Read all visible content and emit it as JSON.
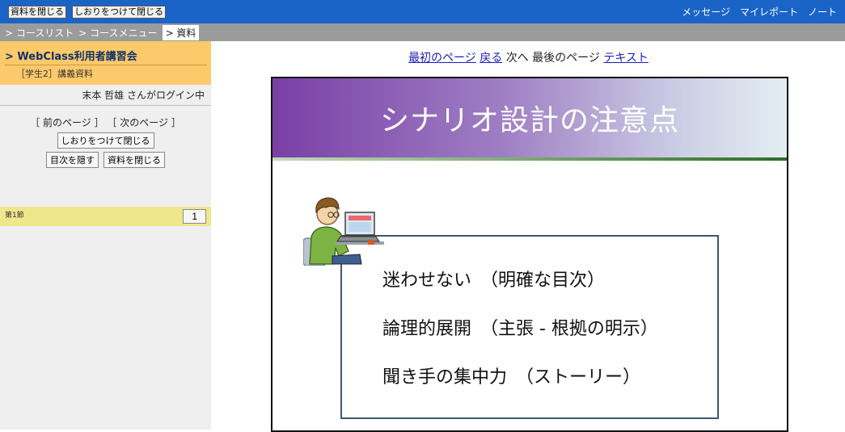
{
  "topbar": {
    "close_button": "資料を閉じる",
    "bookmark_close_button": "しおりをつけて閉じる",
    "links": [
      "メッセージ",
      "マイレポート",
      "ノート"
    ]
  },
  "breadcrumbs": [
    "> コースリスト",
    "> コースメニュー",
    "> 資料"
  ],
  "sidebar": {
    "course_title": "> WebClass利用者講習会",
    "course_sub": "［学生2］講義資料",
    "login_text": "末本 哲雄 さんがログイン中",
    "nav_links": "［ 前のページ ］ ［ 次のページ ］",
    "bookmark_close_button": "しおりをつけて閉じる",
    "hide_toc_button": "目次を隠す",
    "close_button": "資料を閉じる",
    "section_label": "第1節",
    "page_button": "1"
  },
  "pager": {
    "first": "最初のページ",
    "back": "戻る",
    "next": "次へ",
    "last": "最後のページ",
    "text": "テキスト"
  },
  "slide": {
    "title": "シナリオ設計の注意点",
    "lines": [
      "迷わせない　（明確な目次）",
      "論理的展開　（主張 - 根拠の明示）",
      "聞き手の集中力　（ストーリー）"
    ]
  }
}
